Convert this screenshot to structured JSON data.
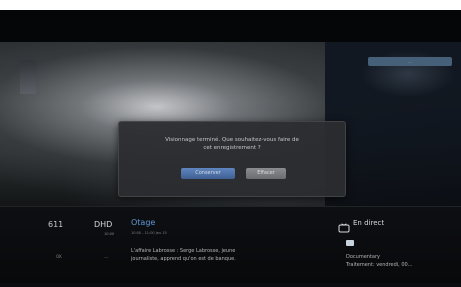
{
  "overlay": {
    "corner_tag": "..."
  },
  "dialog": {
    "message": "Visionnage terminé. Que souhaitez-vous faire de\ncet enregistrement ?",
    "primary_button": "Conserver",
    "secondary_button": "Effacer"
  },
  "info_bar": {
    "channel_number": "611",
    "channel_name": "DHD",
    "channel_time": "10:00",
    "left_small_1": "OK",
    "left_small_2": "---",
    "program_title": "Otage",
    "program_time": "10:00 - 11:00  Jeu 15",
    "program_description": "L'affaire Labrosse : Serge Labrosse, jeune\njournaliste, apprend qu'on est de banque.",
    "live_label": "En direct",
    "genre": "Documentary",
    "genre_detail": "Traitement: vendredi, 00..."
  },
  "colors": {
    "accent": "#5f97d6",
    "dialog_bg": "#2c2d30",
    "button_primary": "#4d73ad",
    "button_secondary": "#7a7c80"
  },
  "icons": {
    "live_icon": "tv-icon",
    "hd_icon": "hd-icon"
  }
}
